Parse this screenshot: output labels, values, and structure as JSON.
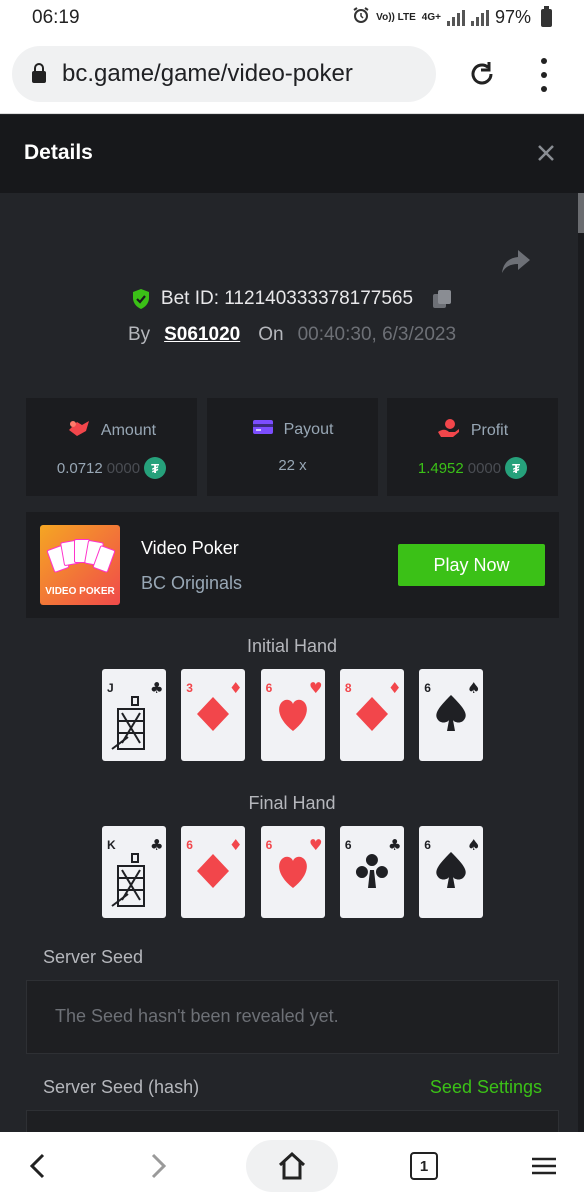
{
  "status_bar": {
    "time": "06:19",
    "lte_label": "Vo)) LTE",
    "net_label": "4G+",
    "battery": "97%"
  },
  "browser": {
    "url": "bc.game/game/video-poker"
  },
  "details": {
    "title": "Details",
    "bet_id_label": "Bet ID: 112140333378177565",
    "by_label": "By",
    "username": "S061020",
    "on_label": "On",
    "datetime": "00:40:30, 6/3/2023"
  },
  "stats": {
    "amount": {
      "label": "Amount",
      "value_main": "0.0712",
      "value_dim": "0000"
    },
    "payout": {
      "label": "Payout",
      "value": "22 x"
    },
    "profit": {
      "label": "Profit",
      "value_main": "1.4952",
      "value_dim": "0000"
    },
    "currency_symbol": "₮"
  },
  "game": {
    "thumb_text": "VIDEO POKER",
    "name": "Video Poker",
    "provider": "BC Originals",
    "play_label": "Play Now"
  },
  "initial_hand": {
    "label": "Initial Hand",
    "cards": [
      {
        "rank": "J",
        "suit": "clubs"
      },
      {
        "rank": "3",
        "suit": "diamonds"
      },
      {
        "rank": "6",
        "suit": "hearts"
      },
      {
        "rank": "8",
        "suit": "diamonds"
      },
      {
        "rank": "6",
        "suit": "spades"
      }
    ]
  },
  "final_hand": {
    "label": "Final Hand",
    "cards": [
      {
        "rank": "K",
        "suit": "clubs"
      },
      {
        "rank": "6",
        "suit": "diamonds"
      },
      {
        "rank": "6",
        "suit": "hearts"
      },
      {
        "rank": "6",
        "suit": "clubs"
      },
      {
        "rank": "6",
        "suit": "spades"
      }
    ]
  },
  "server_seed": {
    "label": "Server Seed",
    "value": "The Seed hasn't been revealed yet."
  },
  "server_seed_hash": {
    "label": "Server Seed (hash)",
    "settings_label": "Seed Settings"
  },
  "bottom_nav": {
    "tab_count": "1"
  },
  "colors": {
    "accent": "#3bc117",
    "background": "#232529",
    "panel": "#1b1c1f",
    "red_suit": "#f2464b"
  }
}
